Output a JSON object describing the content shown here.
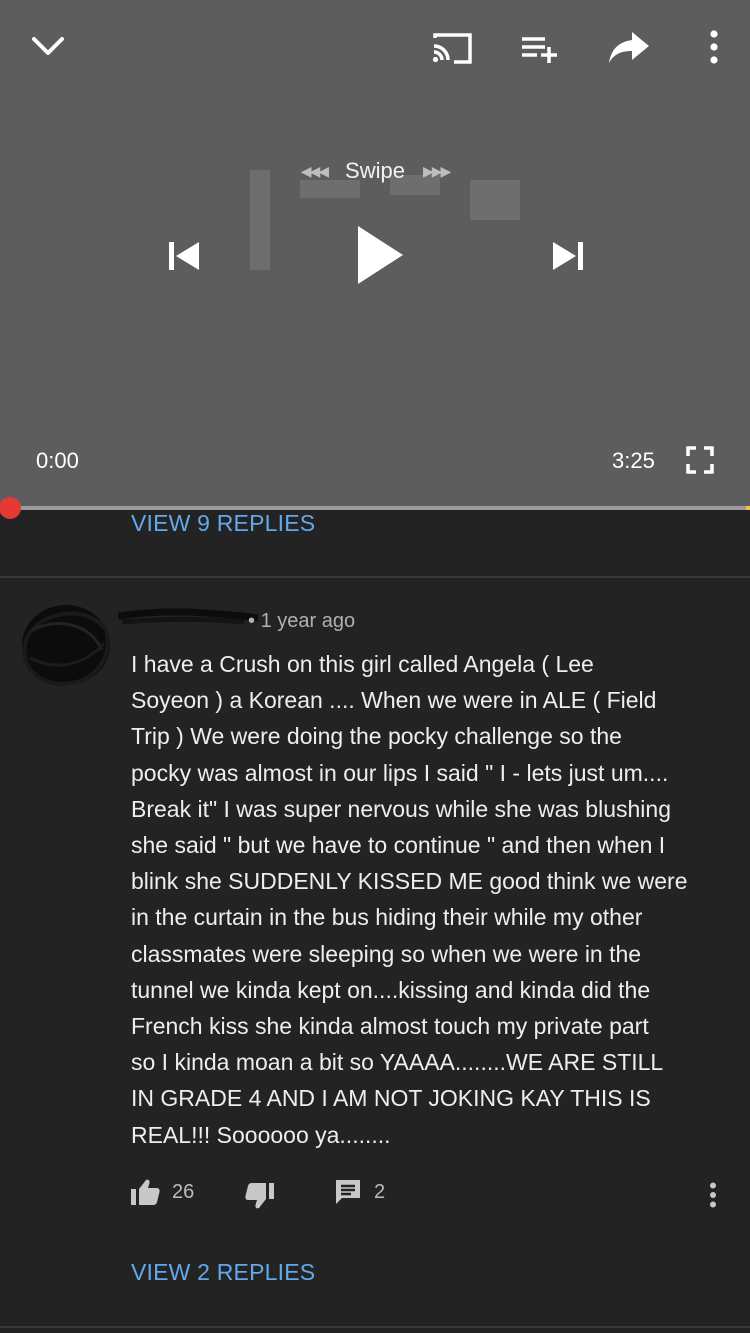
{
  "player": {
    "swipe_label": "Swipe",
    "swipe_left_arrows": "◀◀◀",
    "swipe_right_arrows": "▶▶▶",
    "current_time": "0:00",
    "duration": "3:25",
    "progress": 0.0
  },
  "replies_top": {
    "label": "VIEW 9 REPLIES"
  },
  "comment": {
    "dot": "•",
    "timestamp": "1 year ago",
    "text": "I have a Crush  on this girl called Angela ( Lee\nSoyeon ) a Korean .... When we were in ALE ( Field\nTrip ) We were doing the pocky challenge so the\npocky was almost in our lips I said \" I - lets just um....\nBreak it\" I was super nervous while she was blushing\nshe said \" but we have to continue \" and then when  I\nblink she SUDDENLY KISSED ME good think we were\nin the curtain in the bus hiding their while my other\nclassmates were sleeping so when we were in the\ntunnel we kinda kept on....kissing and kinda did the\nFrench kiss she kinda almost touch my private part\nso I kinda moan a bit so YAAAA........WE ARE STILL\nIN GRADE 4 AND I AM NOT JOKING KAY THIS IS\nREAL!!! Soooooo ya........",
    "likes": "26",
    "reply_count": "2"
  },
  "replies_bottom": {
    "label": "VIEW 2 REPLIES"
  },
  "icons": [
    "chevron-down-icon",
    "cast-icon",
    "add-to-queue-icon",
    "share-icon",
    "more-vert-icon",
    "previous-icon",
    "play-icon",
    "next-icon",
    "fullscreen-icon",
    "thumb-up-icon",
    "thumb-down-icon",
    "comment-icon"
  ],
  "colors": {
    "accent_red": "#e53935",
    "link_blue": "#64a8ec",
    "background": "#232323",
    "player_bg": "#5d5d5d"
  }
}
